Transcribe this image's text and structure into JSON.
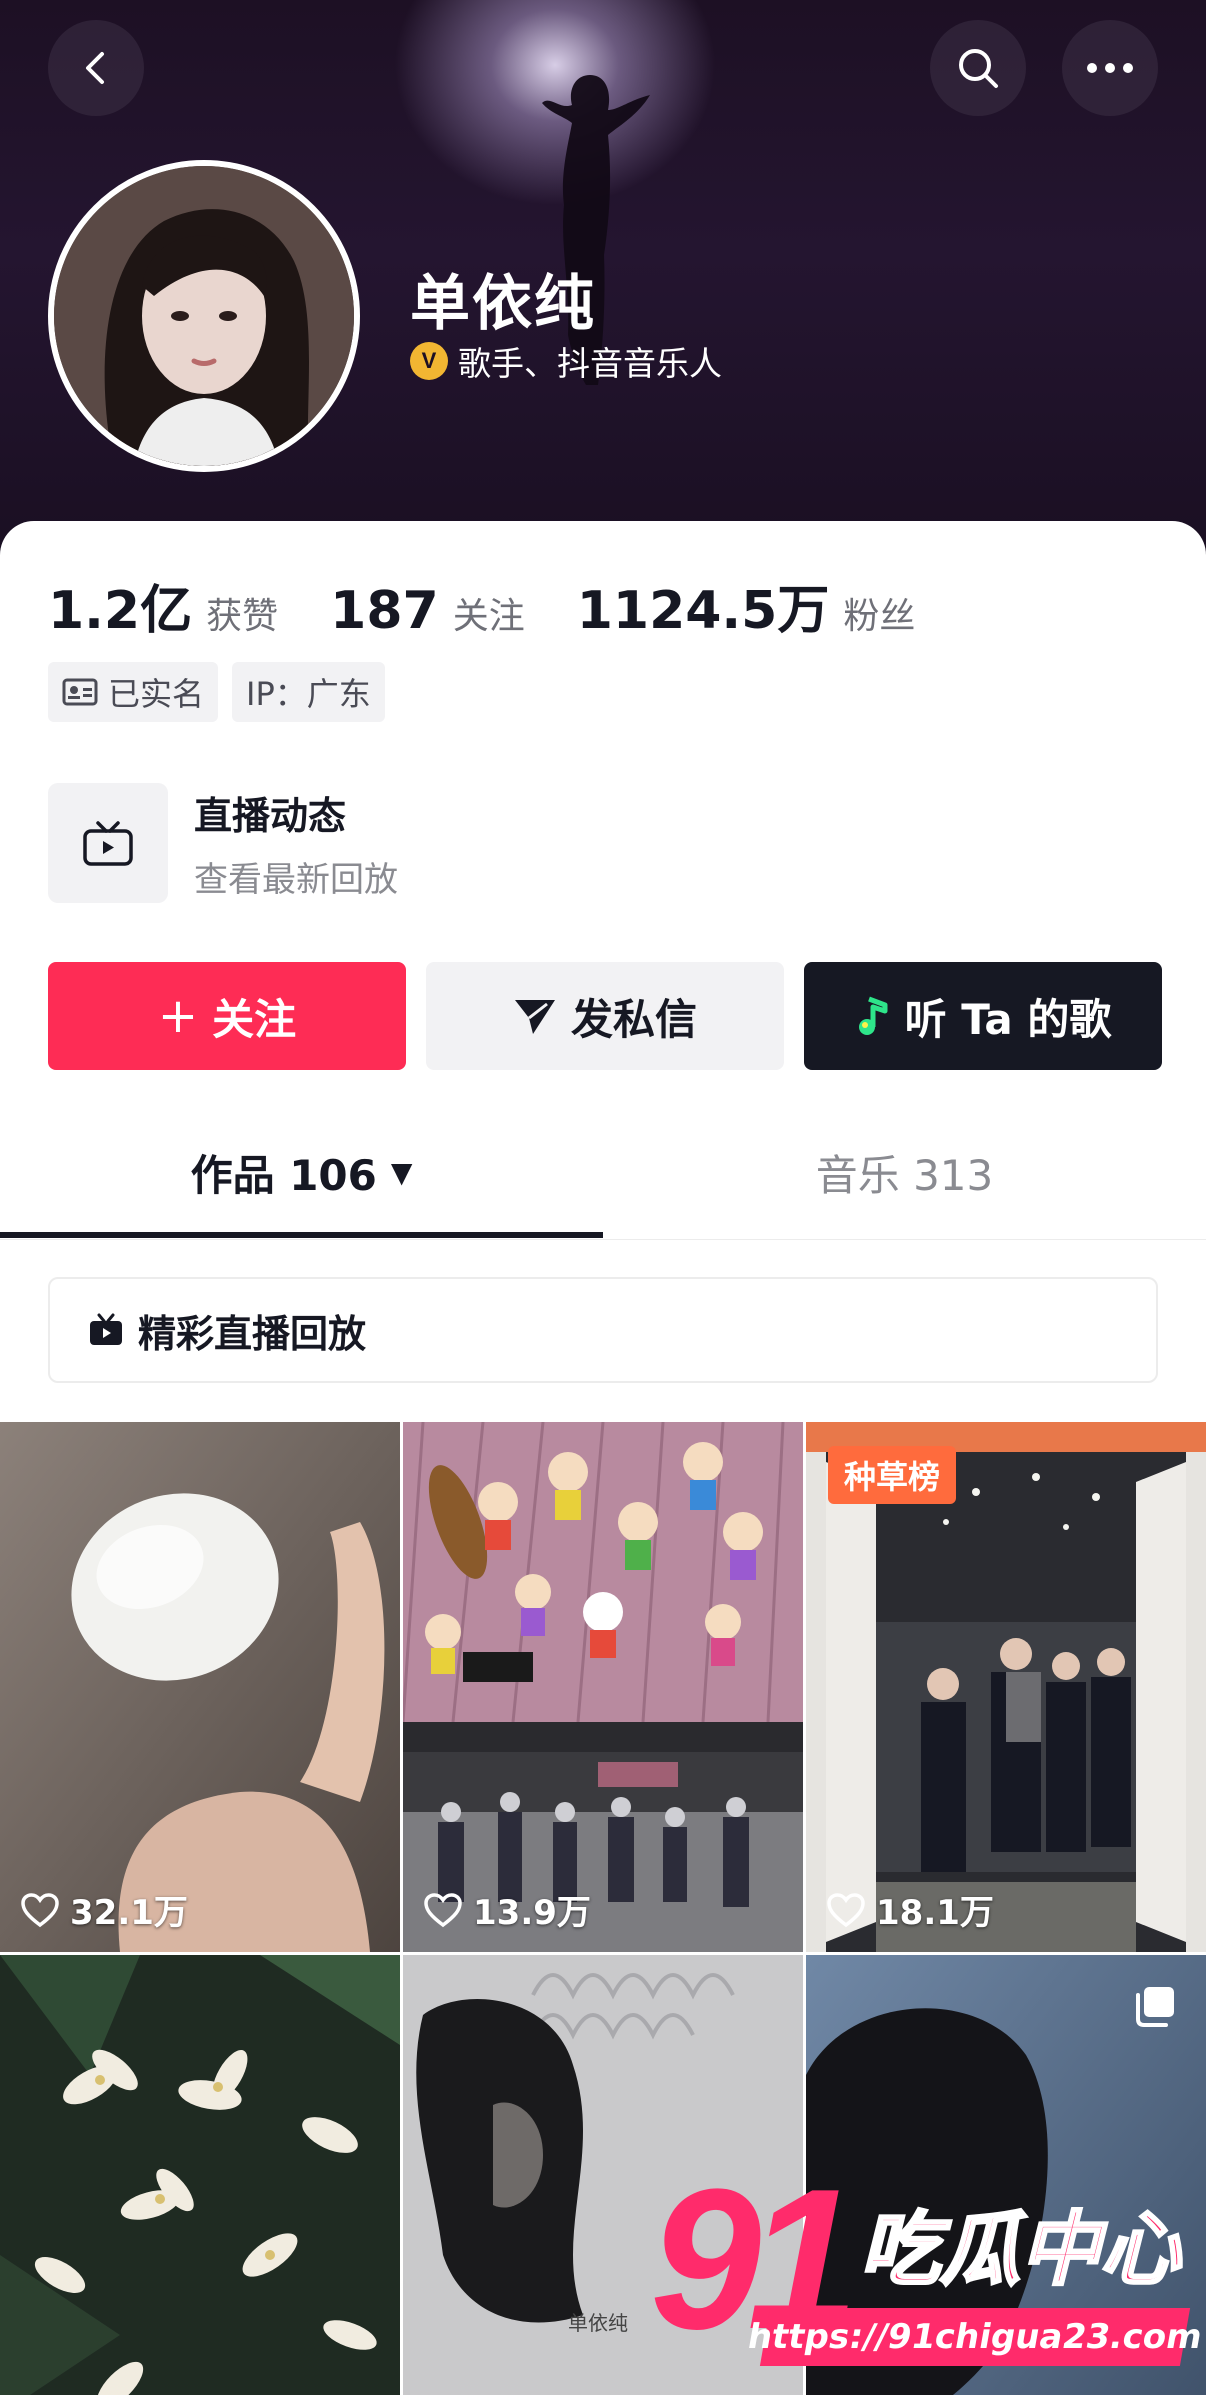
{
  "header": {
    "back_icon": "chevron-left-icon",
    "search_icon": "search-icon",
    "more_icon": "more-dots-icon"
  },
  "profile": {
    "name": "单依纯",
    "verified_badge": "V",
    "verified_text": "歌手、抖音音乐人"
  },
  "stats": [
    {
      "value": "1.2亿",
      "label": "获赞"
    },
    {
      "value": "187",
      "label": "关注"
    },
    {
      "value": "1124.5万",
      "label": "粉丝"
    }
  ],
  "tags": {
    "realname": "已实名",
    "ip": "IP：广东"
  },
  "live": {
    "title": "直播动态",
    "subtitle": "查看最新回放"
  },
  "actions": {
    "follow": "关注",
    "follow_prefix": "+",
    "message": "发私信",
    "listen": "听 Ta 的歌"
  },
  "tabs": {
    "works": "作品 106",
    "works_arrow": "▼",
    "music": "音乐 313"
  },
  "replay": {
    "label": "精彩直播回放"
  },
  "grid": {
    "items": [
      {
        "likes": "32.1万"
      },
      {
        "likes": "13.9万"
      },
      {
        "likes": "18.1万",
        "badge": "种草榜"
      },
      {
        "likes": ""
      },
      {
        "likes": ""
      },
      {
        "likes": ""
      }
    ]
  },
  "watermark": {
    "number": "91",
    "title": "吃瓜中心",
    "url": "https://91chigua23.com"
  },
  "colors": {
    "accent": "#fe2c55",
    "dark_button": "#161823",
    "badge": "#ff6b3d",
    "verify": "#f2b632"
  }
}
